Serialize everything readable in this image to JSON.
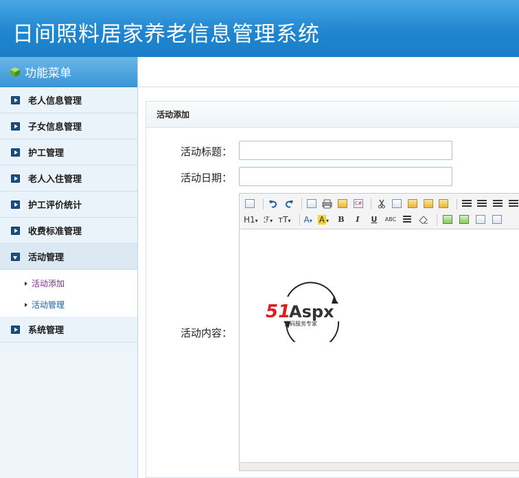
{
  "app": {
    "title": "日间照料居家养老信息管理系统"
  },
  "sidebar": {
    "header": "功能菜单",
    "items": [
      {
        "label": "老人信息管理"
      },
      {
        "label": "子女信息管理"
      },
      {
        "label": "护工管理"
      },
      {
        "label": "老人入住管理"
      },
      {
        "label": "护工评价统计"
      },
      {
        "label": "收费标准管理"
      },
      {
        "label": "活动管理",
        "open": true,
        "children": [
          {
            "label": "活动添加"
          },
          {
            "label": "活动管理"
          }
        ]
      },
      {
        "label": "系统管理"
      }
    ]
  },
  "form": {
    "panel_title": "活动添加",
    "title_label": "活动标题：",
    "title_value": "",
    "date_label": "活动日期：",
    "date_value": "",
    "content_label": "活动内容："
  },
  "editor": {
    "toolbar_row2": {
      "heading": "H1",
      "font": "ℱ",
      "size": "тT",
      "bold": "B",
      "italic": "I",
      "underline": "U",
      "strike": "ABC"
    },
    "logo": {
      "brand": "51Aspx",
      "tagline": "源码服务专家"
    }
  },
  "colors": {
    "header": "#1f86cf",
    "accent": "#3a95d6",
    "logo_red": "#d9201f",
    "logo_green": "#5aa83a"
  }
}
